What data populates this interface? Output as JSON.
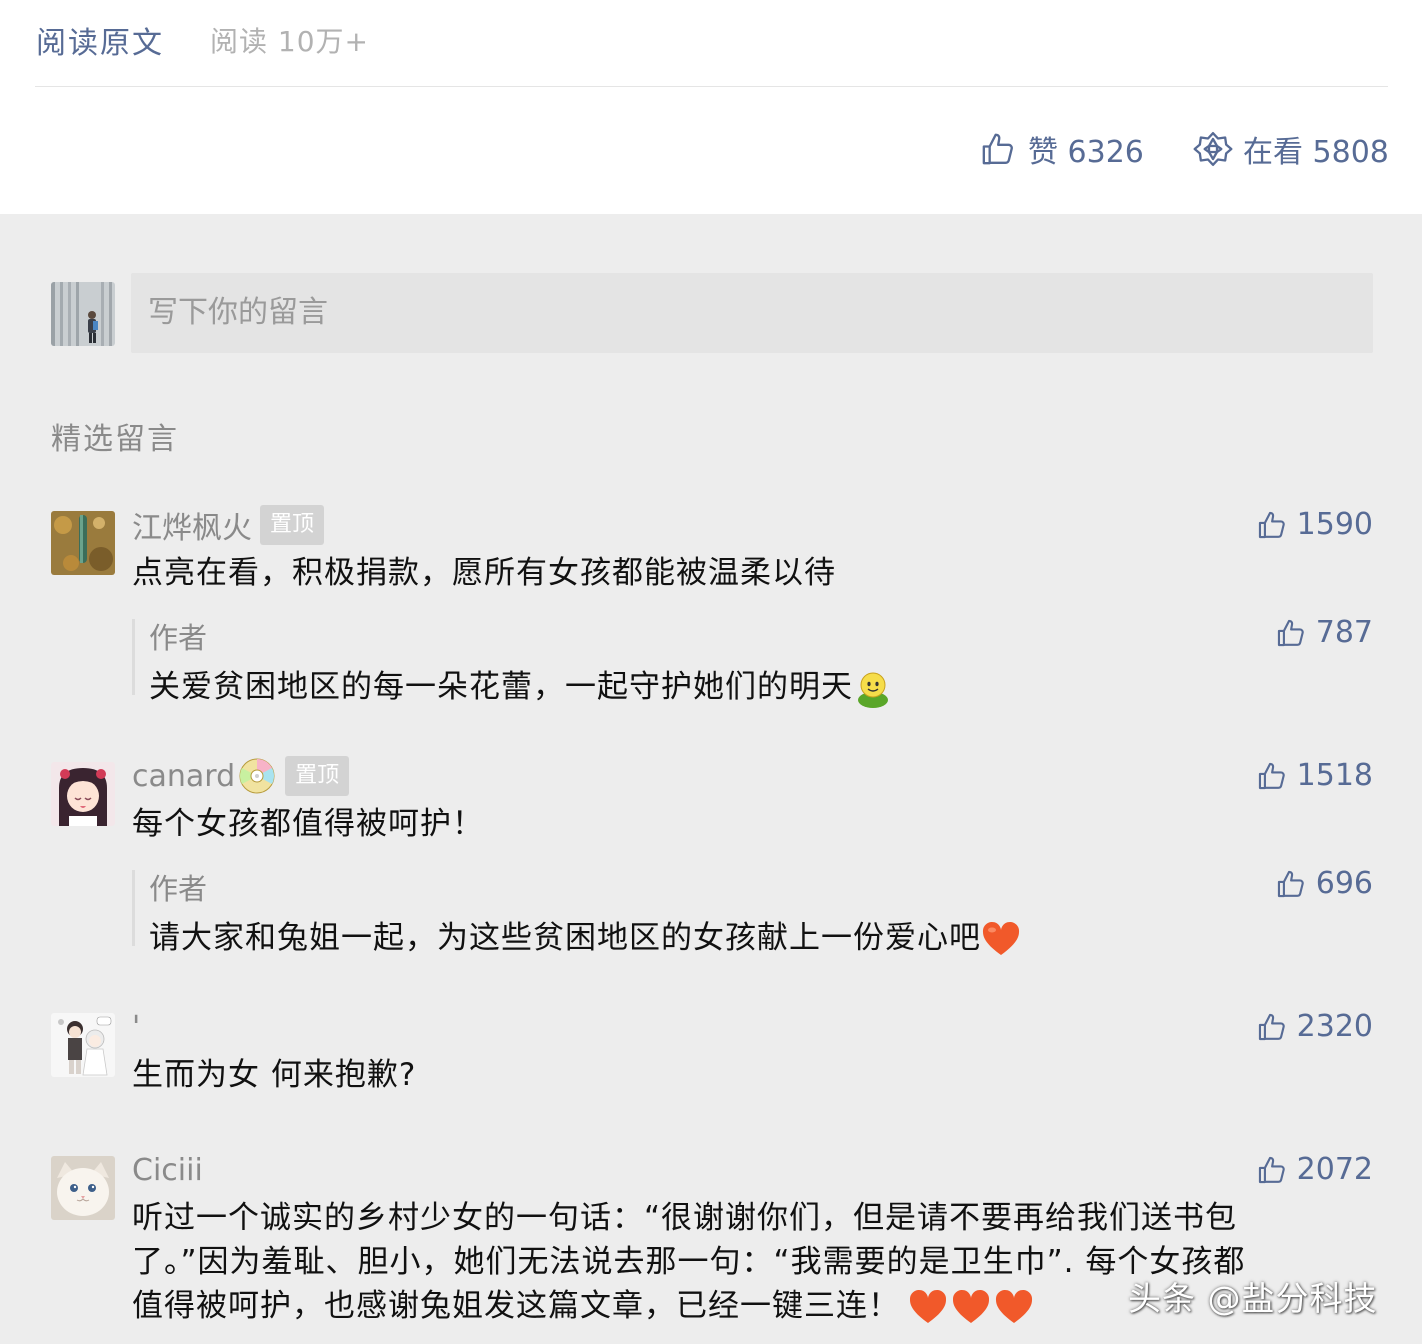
{
  "header": {
    "read_original": "阅读原文",
    "read_count": "阅读 10万+",
    "likes": "赞 6326",
    "watching": "在看 5808"
  },
  "composer": {
    "placeholder": "写下你的留言"
  },
  "section_title": "精选留言",
  "comments": [
    {
      "nick": "江烨枫火",
      "pinned": "置顶",
      "likes": "1590",
      "text": "点亮在看，积极捐款，愿所有女孩都能被温柔以待",
      "reply": {
        "name": "作者",
        "text": "关爱贫困地区的每一朵花蕾，一起守护她们的明天",
        "likes": "787",
        "emoji": "smile-face-emoji"
      }
    },
    {
      "nick": "canard",
      "pinned": "置顶",
      "likes": "1518",
      "text": "每个女孩都值得被呵护！",
      "reply": {
        "name": "作者",
        "text": "请大家和兔姐一起，为这些贫困地区的女孩献上一份爱心吧",
        "likes": "696",
        "emoji": "heart-emoji"
      }
    },
    {
      "nick": "'",
      "likes": "2320",
      "text": "生而为女 何来抱歉?"
    },
    {
      "nick": "Ciciii",
      "likes": "2072",
      "text_lines": [
        "听过一个诚实的乡村少女的一句话：“很谢谢你们，但是请不要再给我们送书包",
        "了。”因为羞耻、胆小，她们无法说去那一句：“我需要的是卫生巾”. 每个女孩都",
        "值得被呵护，也感谢兔姐发这篇文章，已经一键三连！"
      ]
    }
  ],
  "watermark": "头条 @盐分科技",
  "colors": {
    "link": "#576b95",
    "muted": "#8a8a8a",
    "background": "#ededed",
    "input_bg": "#e4e4e4",
    "pin_bg": "#d3d3d3",
    "heart": "#f1592a"
  }
}
